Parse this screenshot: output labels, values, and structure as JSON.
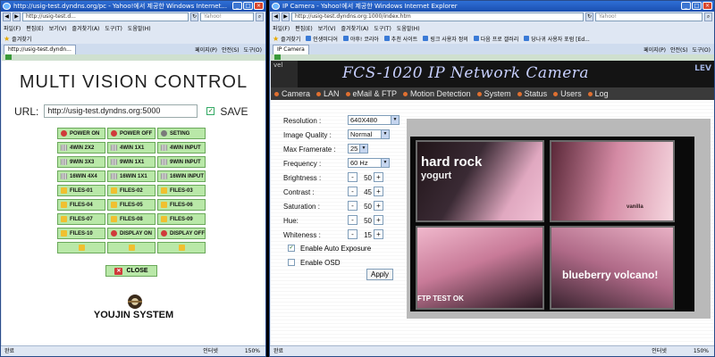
{
  "left_window": {
    "title": "http://usig-test.dyndns.org/pc - Yahoo!에서 제공한 Windows Internet...",
    "address": "http://usig-test.d...",
    "search_placeholder": "Yahoo!",
    "menu": [
      "파일(F)",
      "편집(E)",
      "보기(V)",
      "즐겨찾기(A)",
      "도구(T)",
      "도움말(H)"
    ],
    "favorites_label": "즐겨찾기",
    "tab_label": "http://usig-test.dyndn...",
    "tab_tools": [
      "페이지(P)",
      "안전(S)",
      "도구(O)"
    ],
    "status_left": "완료",
    "status_zone": "인터넷",
    "zoom": "150%",
    "page": {
      "title": "MULTI VISION CONTROL",
      "url_label": "URL:",
      "url_value": "http://usig-test.dyndns.org:5000",
      "save_label": "SAVE",
      "save_checked": true,
      "buttons": [
        {
          "label": "POWER ON",
          "icon": "power-icon"
        },
        {
          "label": "POWER OFF",
          "icon": "power-icon"
        },
        {
          "label": "SETING",
          "icon": "gear-icon"
        },
        {
          "label": "4WIN 2X2",
          "icon": "grid-icon"
        },
        {
          "label": "4WIN 1X1",
          "icon": "grid-icon"
        },
        {
          "label": "4WIN INPUT",
          "icon": "grid-icon"
        },
        {
          "label": "9WIN 3X3",
          "icon": "grid-icon"
        },
        {
          "label": "9WIN 1X1",
          "icon": "grid-icon"
        },
        {
          "label": "9WIN INPUT",
          "icon": "grid-icon"
        },
        {
          "label": "16WIN 4X4",
          "icon": "grid-icon"
        },
        {
          "label": "16WIN 1X1",
          "icon": "grid-icon"
        },
        {
          "label": "16WIN INPUT",
          "icon": "grid-icon"
        },
        {
          "label": "FILES-01",
          "icon": "folder-icon"
        },
        {
          "label": "FILES-02",
          "icon": "folder-icon"
        },
        {
          "label": "FILES-03",
          "icon": "folder-icon"
        },
        {
          "label": "FILES-04",
          "icon": "folder-icon"
        },
        {
          "label": "FILES-05",
          "icon": "folder-icon"
        },
        {
          "label": "FILES-06",
          "icon": "folder-icon"
        },
        {
          "label": "FILES-07",
          "icon": "folder-icon"
        },
        {
          "label": "FILES-08",
          "icon": "folder-icon"
        },
        {
          "label": "FILES-09",
          "icon": "folder-icon"
        },
        {
          "label": "FILES-10",
          "icon": "folder-icon"
        },
        {
          "label": "DISPLAY ON",
          "icon": "power-icon"
        },
        {
          "label": "DISPLAY OFF",
          "icon": "power-icon"
        },
        {
          "label": "",
          "icon": "folder-icon"
        },
        {
          "label": "",
          "icon": "folder-icon"
        },
        {
          "label": "",
          "icon": "folder-icon"
        }
      ],
      "close_label": "CLOSE",
      "brand": "YOUJIN SYSTEM"
    }
  },
  "right_window": {
    "title": "IP Camera - Yahoo!에서 제공한 Windows Internet Explorer",
    "address": "http://usig-test.dyndns.org:1000/index.htm",
    "search_placeholder": "Yahoo!",
    "menu": [
      "파일(F)",
      "편집(E)",
      "보기(V)",
      "즐겨찾기(A)",
      "도구(T)",
      "도움말(H)"
    ],
    "favorites_label": "즐겨찾기",
    "favorites": [
      "인생미디어",
      "야후! 코리아",
      "추천 사이트",
      "링크 사용자 정의",
      "다음 프로 갤러리",
      "당나귀 사용자 포럼 [Ed..."
    ],
    "tab_label": "IP Camera",
    "tab_tools": [
      "페이지(P)",
      "안전(S)",
      "도구(O)"
    ],
    "status_left": "완료",
    "status_zone": "인터넷",
    "zoom": "150%",
    "page": {
      "banner_title": "FCS-1020 IP Network Camera",
      "banner_brand": "LEV",
      "banner_level": "vel",
      "nav": [
        "Camera",
        "LAN",
        "eMail & FTP",
        "Motion Detection",
        "System",
        "Status",
        "Users",
        "Log"
      ],
      "resolution_label": "Resolution :",
      "resolution_value": "640X480",
      "quality_label": "Image Quality :",
      "quality_value": "Normal",
      "framerate_label": "Max Framerate :",
      "framerate_value": "25",
      "frequency_label": "Frequency :",
      "frequency_value": "60 Hz",
      "brightness_label": "Brightness :",
      "brightness_value": "50",
      "contrast_label": "Contrast :",
      "contrast_value": "45",
      "saturation_label": "Saturation :",
      "saturation_value": "50",
      "hue_label": "Hue:",
      "hue_value": "50",
      "whiteness_label": "Whiteness :",
      "whiteness_value": "15",
      "auto_exposure_label": "Enable Auto Exposure",
      "auto_exposure_checked": true,
      "osd_label": "Enable OSD",
      "osd_checked": false,
      "apply_label": "Apply",
      "minus": "-",
      "plus": "+",
      "video_text": {
        "headline": "hard rock",
        "sub": "yogurt",
        "right_top": "vanilla",
        "right_bottom": "blueberry volcano!",
        "caption": "FTP TEST OK"
      }
    }
  }
}
